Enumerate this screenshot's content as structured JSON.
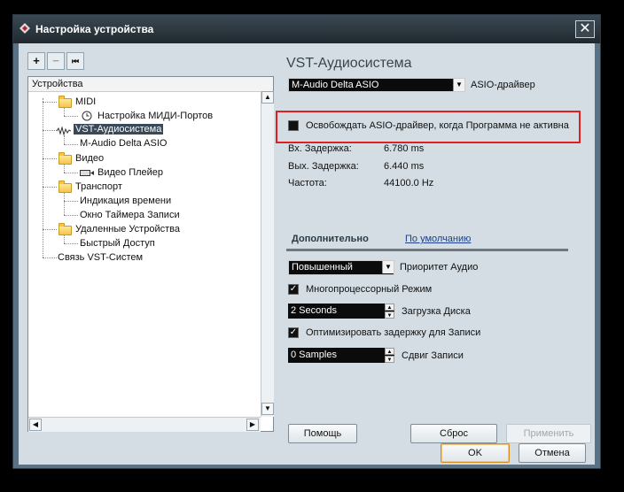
{
  "window": {
    "title": "Настройка устройства",
    "close_glyph": "✕"
  },
  "tree_toolbar": {
    "add": "+",
    "remove": "−",
    "reset": "⏮"
  },
  "tree": {
    "header": "Устройства",
    "nodes": [
      {
        "label": "MIDI",
        "icon": "folder-icon"
      },
      {
        "label": "Настройка МИДИ-Портов",
        "icon": "clock-icon"
      },
      {
        "label": "VST-Аудиосистема",
        "icon": "waveform-icon"
      },
      {
        "label": "M-Audio Delta ASIO",
        "icon": ""
      },
      {
        "label": "Видео",
        "icon": "folder-icon"
      },
      {
        "label": "Видео Плейер",
        "icon": "video-player-icon"
      },
      {
        "label": "Транспорт",
        "icon": "folder-icon"
      },
      {
        "label": "Индикация времени",
        "icon": ""
      },
      {
        "label": "Окно Таймера Записи",
        "icon": ""
      },
      {
        "label": "Удаленные Устройства",
        "icon": "folder-icon"
      },
      {
        "label": "Быстрый Доступ",
        "icon": ""
      },
      {
        "label": "Связь VST-Систем",
        "icon": ""
      }
    ],
    "selected": "VST-Аудиосистема"
  },
  "panel": {
    "title": "VST-Аудиосистема",
    "driver_value": "M-Audio Delta ASIO",
    "driver_label": "ASIO-драйвер",
    "release_driver_label": "Освобождать ASIO-драйвер, когда Программа не активна",
    "input_latency_label": "Вх. Задержка:",
    "input_latency_value": "6.780 ms",
    "output_latency_label": "Вых. Задержка:",
    "output_latency_value": "6.440 ms",
    "rate_label": "Частота:",
    "rate_value": "44100.0 Hz",
    "tab_advanced": "Дополнительно",
    "tab_defaults": "По умолчанию",
    "priority_value": "Повышенный",
    "priority_label": "Приоритет Аудио",
    "multiproc_label": "Многопроцессорный Режим",
    "disk_value": "2 Seconds",
    "disk_label": "Загрузка Диска",
    "optimize_label": "Оптимизировать задержку для Записи",
    "offset_value": "0 Samples",
    "offset_label": "Сдвиг Записи"
  },
  "buttons": {
    "help": "Помощь",
    "reset": "Сброс",
    "apply": "Применить",
    "ok": "OK",
    "cancel": "Отмена"
  },
  "colors": {
    "highlight": "#e02020",
    "accent": "#d88b1c"
  }
}
